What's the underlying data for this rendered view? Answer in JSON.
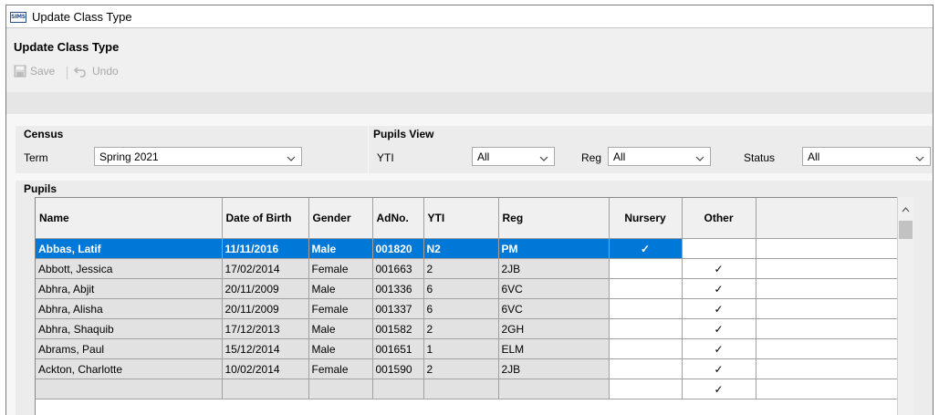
{
  "window": {
    "title": "Update Class Type",
    "app_icon_text": "SIMS"
  },
  "page": {
    "title": "Update Class Type"
  },
  "toolbar": {
    "save_label": "Save",
    "undo_label": "Undo"
  },
  "census": {
    "title": "Census",
    "term_label": "Term",
    "term_value": "Spring 2021"
  },
  "pupils_view": {
    "title": "Pupils View",
    "yti_label": "YTI",
    "yti_value": "All",
    "reg_label": "Reg",
    "reg_value": "All",
    "status_label": "Status",
    "status_value": "All"
  },
  "pupils": {
    "title": "Pupils",
    "columns": [
      "Name",
      "Date of Birth",
      "Gender",
      "AdNo.",
      "YTI",
      "Reg",
      "Nursery",
      "Other"
    ],
    "rows": [
      {
        "name": "Abbas, Latif",
        "dob": "11/11/2016",
        "gender": "Male",
        "adno": "001820",
        "yti": "N2",
        "reg": "PM",
        "nursery": "✓",
        "other": ""
      },
      {
        "name": "Abbott, Jessica",
        "dob": "17/02/2014",
        "gender": "Female",
        "adno": "001663",
        "yti": "2",
        "reg": "2JB",
        "nursery": "",
        "other": "✓"
      },
      {
        "name": "Abhra, Abjit",
        "dob": "20/11/2009",
        "gender": "Male",
        "adno": "001336",
        "yti": "6",
        "reg": "6VC",
        "nursery": "",
        "other": "✓"
      },
      {
        "name": "Abhra, Alisha",
        "dob": "20/11/2009",
        "gender": "Female",
        "adno": "001337",
        "yti": "6",
        "reg": "6VC",
        "nursery": "",
        "other": "✓"
      },
      {
        "name": "Abhra, Shaquib",
        "dob": "17/12/2013",
        "gender": "Male",
        "adno": "001582",
        "yti": "2",
        "reg": "2GH",
        "nursery": "",
        "other": "✓"
      },
      {
        "name": "Abrams, Paul",
        "dob": "15/12/2014",
        "gender": "Male",
        "adno": "001651",
        "yti": "1",
        "reg": "ELM",
        "nursery": "",
        "other": "✓"
      },
      {
        "name": "Ackton, Charlotte",
        "dob": "10/02/2014",
        "gender": "Female",
        "adno": "001590",
        "yti": "2",
        "reg": "2JB",
        "nursery": "",
        "other": "✓"
      },
      {
        "name": "",
        "dob": "",
        "gender": "",
        "adno": "",
        "yti": "",
        "reg": "",
        "nursery": "",
        "other": "✓"
      }
    ]
  },
  "colors": {
    "selection": "#0078d7",
    "readonly_cell": "#e2e2e2"
  }
}
